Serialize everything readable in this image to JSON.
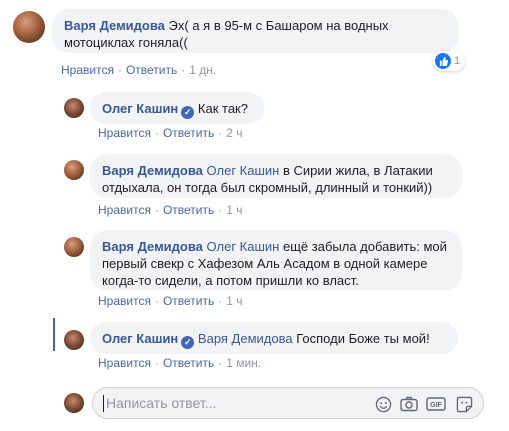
{
  "labels": {
    "like": "Нравится",
    "reply": "Ответить",
    "separator": "·"
  },
  "comments": [
    {
      "author": "Варя Демидова",
      "text": "Эх( а я в 95-м с Башаром на водных мотоциклах гоняла((",
      "time": "1 дн.",
      "reactions": "1"
    },
    {
      "author": "Олег Кашин",
      "text": "Как так?",
      "time": "2 ч"
    },
    {
      "author": "Варя Демидова",
      "mention": "Олег Кашин",
      "text": "в Сирии жила, в Латакии отдыхала, он тогда был скромный, длинный и тонкий))",
      "time": "1 ч"
    },
    {
      "author": "Варя Демидова",
      "mention": "Олег Кашин",
      "text": "ещё забыла добавить: мой первый свекр с Хафезом Аль Асадом в одной камере когда-то сидели, а потом пришли ко власт.",
      "time": "1 ч"
    },
    {
      "author": "Олег Кашин",
      "mention": "Варя Демидова",
      "text": "Господи Боже ты мой!",
      "time": "1 мин."
    }
  ],
  "reply_box": {
    "placeholder": "Написать ответ..."
  },
  "icons": [
    "smile-icon",
    "camera-icon",
    "gif-icon",
    "sticker-icon"
  ],
  "colors": {
    "link": "#385898",
    "bubble": "#f2f3f5",
    "meta": "#90949c",
    "like": "#1877f2"
  }
}
